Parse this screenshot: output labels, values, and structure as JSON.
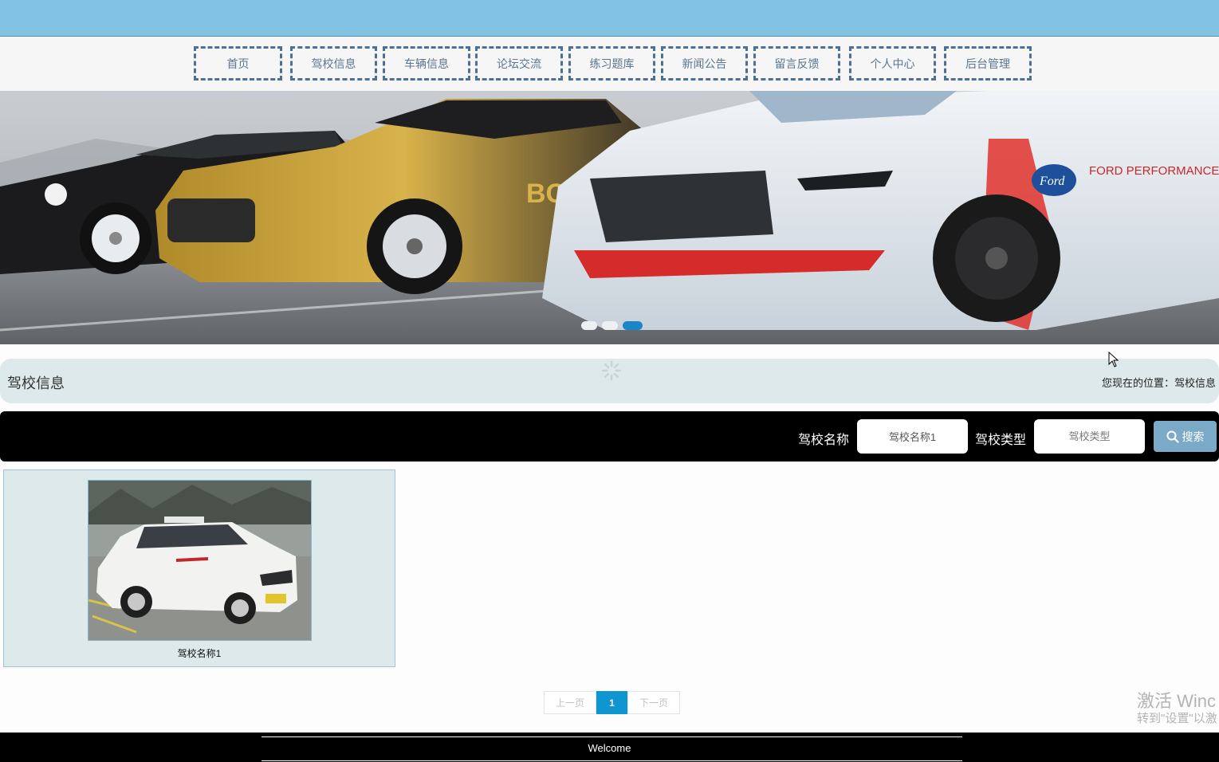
{
  "nav": {
    "items": [
      {
        "label": "首页"
      },
      {
        "label": "驾校信息"
      },
      {
        "label": "车辆信息"
      },
      {
        "label": "论坛交流"
      },
      {
        "label": "练习题库"
      },
      {
        "label": "新闻公告"
      },
      {
        "label": "留言反馈"
      },
      {
        "label": "个人中心"
      },
      {
        "label": "后台管理"
      }
    ]
  },
  "banner": {
    "slide_count": 3,
    "active_slide": 3,
    "image_icon": "cars-photo"
  },
  "location": {
    "title": "驾校信息",
    "path": "您现在的位置：驾校信息"
  },
  "search": {
    "name_label": "驾校名称",
    "name_value": "驾校名称1",
    "type_label": "驾校类型",
    "type_placeholder": "驾校类型",
    "button_label": "搜索",
    "button_icon": "search-icon"
  },
  "results": [
    {
      "name": "驾校名称1",
      "image_icon": "driving-school-car-photo"
    }
  ],
  "pager": {
    "prev_label": "上一页",
    "current": "1",
    "next_label": "下一页"
  },
  "watermark": {
    "line1": "激活 Winc",
    "line2": "转到\"设置\"以激"
  },
  "footer": {
    "text": "Welcome"
  },
  "colors": {
    "topbar": "#82c2e2",
    "nav_border": "#4d7195",
    "location_bg": "#dde9ea",
    "search_bg": "#000000",
    "search_button": "#7aaac8",
    "pager_active": "#0f95d0",
    "dot_active": "#1a86c8"
  }
}
